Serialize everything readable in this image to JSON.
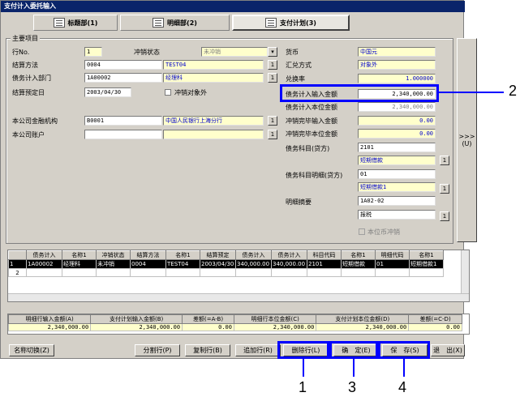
{
  "window": {
    "title": "支付计入委托输入"
  },
  "tabs": [
    {
      "label": "标题部(1)",
      "icon": "document-icon"
    },
    {
      "label": "明细部(2)",
      "icon": "list-icon"
    },
    {
      "label": "支付计划(3)",
      "icon": "monitor-icon"
    }
  ],
  "group_title": "主要项目",
  "left": {
    "row_no_label": "行No.",
    "row_no_value": "1",
    "status_label": "冲销状态",
    "status_value": "未冲销",
    "settle_method_label": "结算方法",
    "settle_method_code": "0004",
    "settle_method_name": "TEST04",
    "dept_label": "债务计入部门",
    "dept_code": "1A00002",
    "dept_name": "经理科",
    "settle_date_label": "结算预定日",
    "settle_date_value": "2003/04/30",
    "offset_target_label": "冲销对象外",
    "bank_label": "本公司金融机构",
    "bank_code": "B0001",
    "bank_name": "中国人民银行上海分行",
    "account_label": "本公司账户",
    "account_code": "",
    "account_name": ""
  },
  "right": {
    "currency_label": "货币",
    "currency_value": "中国元",
    "exchange_label": "汇兑方式",
    "exchange_value": "对象外",
    "rate_label": "兑换率",
    "rate_value": "1.000000",
    "debt_input_label": "债务计入输入金额",
    "debt_input_value": "2,340,000.00",
    "debt_base_label": "债务计入本位金额",
    "debt_base_value": "2,340,000.00",
    "offset_input_label": "冲销完毕输入金额",
    "offset_input_value": "0.00",
    "offset_base_label": "冲销完毕本位金额",
    "offset_base_value": "0.00",
    "debt_subject_label": "债务科目(贷方)",
    "debt_subject_code": "2101",
    "debt_subject_name": "短期借款",
    "debt_detail_label": "债务科目明细(贷方)",
    "debt_detail_code": "01",
    "debt_detail_name": "短期借款1",
    "summary_label": "明细摘要",
    "summary_code": "1A02-02",
    "summary_name": "报税",
    "local_offset_label": "本位币冲销"
  },
  "side_button": {
    "label": ">>>",
    "shortcut": "(U)"
  },
  "grid": {
    "headers": [
      "",
      "债务计入",
      "名称1",
      "冲销状态",
      "结算方法",
      "名称1",
      "结算预定",
      "债务计入",
      "债务计入",
      "科目代码",
      "名称1",
      "明细代码",
      "名称1"
    ],
    "rows": [
      [
        "1",
        "1A00002",
        "经理科",
        "未冲销",
        "0004",
        "TEST04",
        "2003/04/30",
        "340,000.00",
        "340,000.00",
        "2101",
        "短期借款",
        "01",
        "短期借款1"
      ],
      [
        "2",
        "",
        "",
        "",
        "",
        "",
        "",
        "",
        "",
        "",
        "",
        "",
        ""
      ]
    ]
  },
  "summary": {
    "headers": [
      "明细行输入金额(A)",
      "支付计划输入金额(B)",
      "差额(=A-B)",
      "明细行本位金额(C)",
      "支付计划本位金额(D)",
      "差额(=C-D)"
    ],
    "values": [
      "2,340,000.00",
      "2,340,000.00",
      "0.00",
      "2,340,000.00",
      "2,340,000.00",
      "0.00"
    ]
  },
  "buttons": {
    "name_switch": "名称切换(Z)",
    "split_row": "分割行(P)",
    "copy_row": "复制行(B)",
    "add_row": "追加行(R)",
    "delete_row": "删除行(L)",
    "confirm": "确　定(E)",
    "save": "保　存(S)",
    "exit": "退　出(X)"
  },
  "callouts": {
    "c1": "1",
    "c2": "2",
    "c3": "3",
    "c4": "4"
  },
  "colors": {
    "highlight": "#0000ff",
    "title_bar": "#0a246a",
    "yellow_field": "#ffffcc"
  }
}
